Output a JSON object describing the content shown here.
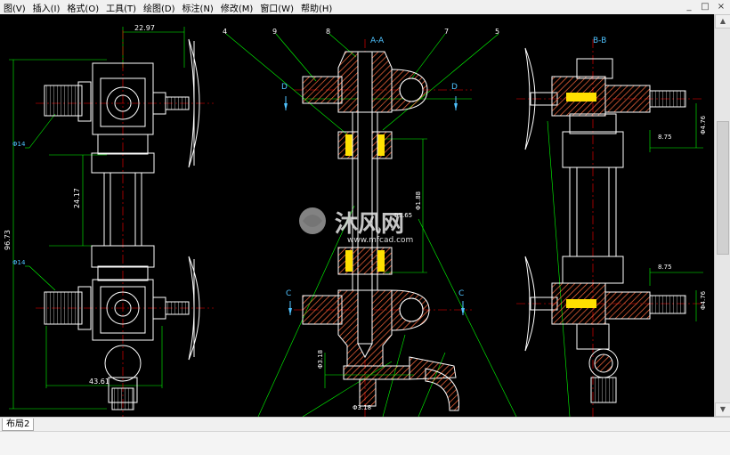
{
  "menu": [
    {
      "label": "图(V)"
    },
    {
      "label": "插入(I)"
    },
    {
      "label": "格式(O)"
    },
    {
      "label": "工具(T)"
    },
    {
      "label": "绘图(D)"
    },
    {
      "label": "标注(N)"
    },
    {
      "label": "修改(M)"
    },
    {
      "label": "窗口(W)"
    },
    {
      "label": "帮助(H)"
    }
  ],
  "window_controls": [
    "_",
    "□",
    "×"
  ],
  "layout_tab": "布局2",
  "drawing": {
    "section_aa": "A-A",
    "section_bb": "B-B",
    "view_d": "D",
    "view_c": "C",
    "callouts": [
      "4",
      "9",
      "8",
      "7",
      "5"
    ],
    "dims": {
      "top_width": "22.97",
      "left_total": "96.73",
      "mid_height": "24.17",
      "bottom_width": "43.61",
      "phi_label_1": "Φ14",
      "phi_label_2": "Φ14",
      "center_vert": "Φ1.88",
      "center_small": "Φ1.65",
      "right_875_a": "8.75",
      "right_875_b": "8.75",
      "right_phi_a": "Φ4.76",
      "right_phi_b": "Φ4.76",
      "bottom_318": "Φ3.18",
      "bottom_phi318": "Φ3.18"
    },
    "watermark_cn": "沐风网",
    "watermark_url": "www.mfcad.com"
  },
  "colors": {
    "canvas": "#000000",
    "outline": "#ffffff",
    "dim": "#00ff00",
    "center": "#ff0000",
    "hatch": "#ff6a3d",
    "cyan": "#4fc3ff",
    "yellow": "#ffe000"
  }
}
